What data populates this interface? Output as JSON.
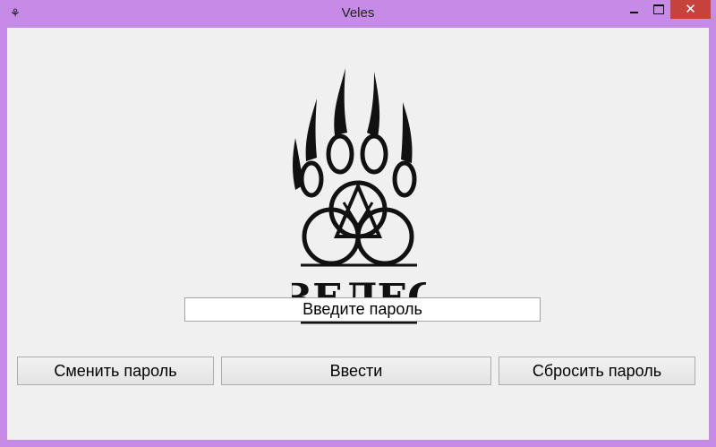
{
  "window": {
    "title": "Veles",
    "app_icon": "paw-rune-icon",
    "controls": {
      "minimize": "minimize-icon",
      "maximize": "maximize-icon",
      "close_label": "✕"
    },
    "frame_color": "#c58be6"
  },
  "logo": {
    "name": "veles-paw-logo",
    "text": "ВЕЛЕС"
  },
  "password": {
    "value": "Введите пароль"
  },
  "buttons": {
    "change_password": "Сменить пароль",
    "enter": "Ввести",
    "reset_password": "Сбросить пароль"
  }
}
